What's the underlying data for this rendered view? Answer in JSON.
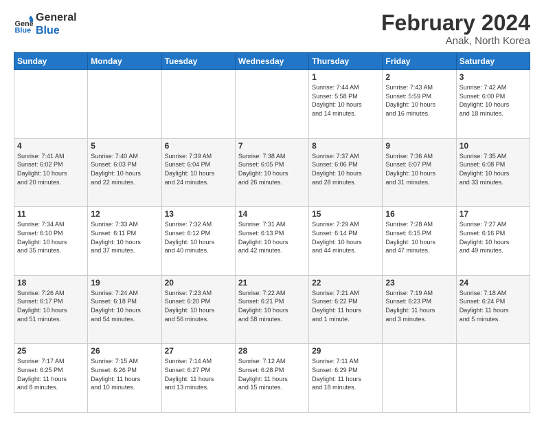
{
  "logo": {
    "line1": "General",
    "line2": "Blue"
  },
  "title": "February 2024",
  "subtitle": "Anak, North Korea",
  "weekdays": [
    "Sunday",
    "Monday",
    "Tuesday",
    "Wednesday",
    "Thursday",
    "Friday",
    "Saturday"
  ],
  "weeks": [
    [
      {
        "day": "",
        "info": ""
      },
      {
        "day": "",
        "info": ""
      },
      {
        "day": "",
        "info": ""
      },
      {
        "day": "",
        "info": ""
      },
      {
        "day": "1",
        "info": "Sunrise: 7:44 AM\nSunset: 5:58 PM\nDaylight: 10 hours\nand 14 minutes."
      },
      {
        "day": "2",
        "info": "Sunrise: 7:43 AM\nSunset: 5:59 PM\nDaylight: 10 hours\nand 16 minutes."
      },
      {
        "day": "3",
        "info": "Sunrise: 7:42 AM\nSunset: 6:00 PM\nDaylight: 10 hours\nand 18 minutes."
      }
    ],
    [
      {
        "day": "4",
        "info": "Sunrise: 7:41 AM\nSunset: 6:02 PM\nDaylight: 10 hours\nand 20 minutes."
      },
      {
        "day": "5",
        "info": "Sunrise: 7:40 AM\nSunset: 6:03 PM\nDaylight: 10 hours\nand 22 minutes."
      },
      {
        "day": "6",
        "info": "Sunrise: 7:39 AM\nSunset: 6:04 PM\nDaylight: 10 hours\nand 24 minutes."
      },
      {
        "day": "7",
        "info": "Sunrise: 7:38 AM\nSunset: 6:05 PM\nDaylight: 10 hours\nand 26 minutes."
      },
      {
        "day": "8",
        "info": "Sunrise: 7:37 AM\nSunset: 6:06 PM\nDaylight: 10 hours\nand 28 minutes."
      },
      {
        "day": "9",
        "info": "Sunrise: 7:36 AM\nSunset: 6:07 PM\nDaylight: 10 hours\nand 31 minutes."
      },
      {
        "day": "10",
        "info": "Sunrise: 7:35 AM\nSunset: 6:08 PM\nDaylight: 10 hours\nand 33 minutes."
      }
    ],
    [
      {
        "day": "11",
        "info": "Sunrise: 7:34 AM\nSunset: 6:10 PM\nDaylight: 10 hours\nand 35 minutes."
      },
      {
        "day": "12",
        "info": "Sunrise: 7:33 AM\nSunset: 6:11 PM\nDaylight: 10 hours\nand 37 minutes."
      },
      {
        "day": "13",
        "info": "Sunrise: 7:32 AM\nSunset: 6:12 PM\nDaylight: 10 hours\nand 40 minutes."
      },
      {
        "day": "14",
        "info": "Sunrise: 7:31 AM\nSunset: 6:13 PM\nDaylight: 10 hours\nand 42 minutes."
      },
      {
        "day": "15",
        "info": "Sunrise: 7:29 AM\nSunset: 6:14 PM\nDaylight: 10 hours\nand 44 minutes."
      },
      {
        "day": "16",
        "info": "Sunrise: 7:28 AM\nSunset: 6:15 PM\nDaylight: 10 hours\nand 47 minutes."
      },
      {
        "day": "17",
        "info": "Sunrise: 7:27 AM\nSunset: 6:16 PM\nDaylight: 10 hours\nand 49 minutes."
      }
    ],
    [
      {
        "day": "18",
        "info": "Sunrise: 7:26 AM\nSunset: 6:17 PM\nDaylight: 10 hours\nand 51 minutes."
      },
      {
        "day": "19",
        "info": "Sunrise: 7:24 AM\nSunset: 6:18 PM\nDaylight: 10 hours\nand 54 minutes."
      },
      {
        "day": "20",
        "info": "Sunrise: 7:23 AM\nSunset: 6:20 PM\nDaylight: 10 hours\nand 56 minutes."
      },
      {
        "day": "21",
        "info": "Sunrise: 7:22 AM\nSunset: 6:21 PM\nDaylight: 10 hours\nand 58 minutes."
      },
      {
        "day": "22",
        "info": "Sunrise: 7:21 AM\nSunset: 6:22 PM\nDaylight: 11 hours\nand 1 minute."
      },
      {
        "day": "23",
        "info": "Sunrise: 7:19 AM\nSunset: 6:23 PM\nDaylight: 11 hours\nand 3 minutes."
      },
      {
        "day": "24",
        "info": "Sunrise: 7:18 AM\nSunset: 6:24 PM\nDaylight: 11 hours\nand 5 minutes."
      }
    ],
    [
      {
        "day": "25",
        "info": "Sunrise: 7:17 AM\nSunset: 6:25 PM\nDaylight: 11 hours\nand 8 minutes."
      },
      {
        "day": "26",
        "info": "Sunrise: 7:15 AM\nSunset: 6:26 PM\nDaylight: 11 hours\nand 10 minutes."
      },
      {
        "day": "27",
        "info": "Sunrise: 7:14 AM\nSunset: 6:27 PM\nDaylight: 11 hours\nand 13 minutes."
      },
      {
        "day": "28",
        "info": "Sunrise: 7:12 AM\nSunset: 6:28 PM\nDaylight: 11 hours\nand 15 minutes."
      },
      {
        "day": "29",
        "info": "Sunrise: 7:11 AM\nSunset: 6:29 PM\nDaylight: 11 hours\nand 18 minutes."
      },
      {
        "day": "",
        "info": ""
      },
      {
        "day": "",
        "info": ""
      }
    ]
  ]
}
